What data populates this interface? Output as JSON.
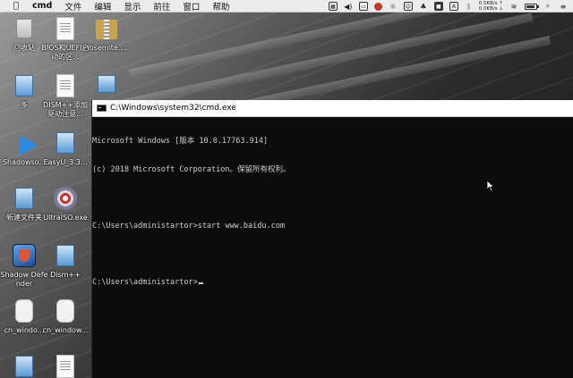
{
  "menubar": {
    "apple_icon": "apple-icon",
    "app_name": "cmd",
    "items": [
      "文件",
      "编辑",
      "显示",
      "前往",
      "窗口",
      "帮助"
    ],
    "network_speed": {
      "upload": "0.5KB/s",
      "download": "0.0KB/s"
    }
  },
  "desktop": {
    "icons": [
      {
        "label": "回收站"
      },
      {
        "label": "BIOS和UEFI启动的区..."
      },
      {
        "label": "Yosemite...."
      },
      {
        "label": "多"
      },
      {
        "label": "DISM++添加驱动注意..."
      },
      {
        "label": ""
      },
      {
        "label": "Shadowso..."
      },
      {
        "label": "EasyU_3.3..."
      },
      {
        "label": "新建文件夹"
      },
      {
        "label": "UltraISO.exe"
      },
      {
        "label": "Shadow Defender"
      },
      {
        "label": "Dism++"
      },
      {
        "label": "cn_windo..."
      },
      {
        "label": "cn_window..."
      },
      {
        "label": ""
      },
      {
        "label": ""
      }
    ]
  },
  "cmd": {
    "title": "C:\\Windows\\system32\\cmd.exe",
    "lines": [
      "Microsoft Windows [版本 10.0.17763.914]",
      "(c) 2018 Microsoft Corporation。保留所有权利。",
      "",
      "C:\\Users\\administartor>start www.baidu.com",
      "",
      "C:\\Users\\administartor>"
    ]
  },
  "colors": {
    "cmd_background": "#0c0c0c",
    "cmd_text": "#cccccc",
    "menubar_background": "#ececec"
  }
}
